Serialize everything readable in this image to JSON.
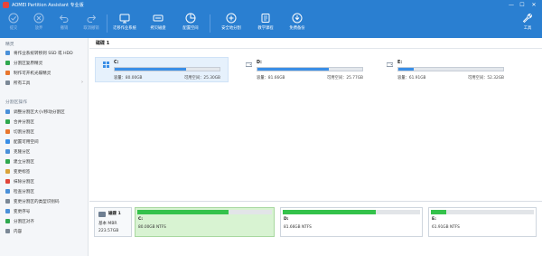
{
  "app": {
    "title": "AOMEI Partition Assistant 专业版"
  },
  "window_controls": {
    "minimize": "—",
    "maximize": "☐",
    "close": "✕"
  },
  "toolbar": {
    "buttons": [
      {
        "label": "提交",
        "icon": "check-icon",
        "enabled": false
      },
      {
        "label": "放弃",
        "icon": "discard-icon",
        "enabled": false
      },
      {
        "label": "撤销",
        "icon": "undo-icon",
        "enabled": false
      },
      {
        "label": "取消撤销",
        "icon": "redo-icon",
        "enabled": false
      },
      {
        "label": "迁移作业系统",
        "icon": "migrate-os-icon",
        "enabled": true
      },
      {
        "label": "拷贝磁盘",
        "icon": "copy-disk-icon",
        "enabled": true
      },
      {
        "label": "配置空间",
        "icon": "allocate-space-icon",
        "enabled": true
      },
      {
        "label": "安全地分割",
        "icon": "secure-split-icon",
        "enabled": true
      },
      {
        "label": "教学课程",
        "icon": "tutorial-icon",
        "enabled": true
      },
      {
        "label": "免费备份",
        "icon": "free-backup-icon",
        "enabled": true
      }
    ],
    "tools_label": "工具"
  },
  "sidebar": {
    "wizard_heading": "精灵",
    "wizard_items": [
      {
        "label": "将作业系统转移到 SSD 或 HDD",
        "icon": "migrate-icon",
        "color": "#4a90d9"
      },
      {
        "label": "分割区复原精灵",
        "icon": "recovery-icon",
        "color": "#2fa84f"
      },
      {
        "label": "制作可开机光碟精灵",
        "icon": "bootable-media-icon",
        "color": "#e8762d"
      },
      {
        "label": "所有工具",
        "icon": "all-tools-icon",
        "color": "#7b8896",
        "chevron": "›"
      }
    ],
    "ops_heading": "分割区操作",
    "ops_items": [
      {
        "label": "调整分割区大小/移动分割区",
        "icon": "resize-icon",
        "color": "#4a90d9"
      },
      {
        "label": "合并分割区",
        "icon": "merge-icon",
        "color": "#2fa84f"
      },
      {
        "label": "切割分割区",
        "icon": "split-icon",
        "color": "#e8762d"
      },
      {
        "label": "配置可用空间",
        "icon": "allocate-icon",
        "color": "#3a8ee6"
      },
      {
        "label": "克隆分区",
        "icon": "clone-icon",
        "color": "#4a90d9"
      },
      {
        "label": "建立分割区",
        "icon": "create-icon",
        "color": "#2fa84f"
      },
      {
        "label": "变更标签",
        "icon": "label-icon",
        "color": "#d9a33a"
      },
      {
        "label": "抹除分割区",
        "icon": "wipe-icon",
        "color": "#e0453a"
      },
      {
        "label": "检查分割区",
        "icon": "check-partition-icon",
        "color": "#4a90d9"
      },
      {
        "label": "变更分割区的类型识别码",
        "icon": "type-id-icon",
        "color": "#7b8896"
      },
      {
        "label": "变更序号",
        "icon": "serial-icon",
        "color": "#4a90d9"
      },
      {
        "label": "分割区对齐",
        "icon": "align-icon",
        "color": "#2fa84f"
      },
      {
        "label": "内容",
        "icon": "properties-icon",
        "color": "#7b8896"
      }
    ]
  },
  "main": {
    "disk_title": "磁碟 1",
    "partitions": [
      {
        "letter": "C:",
        "capacity": "容量：80.00GB",
        "free": "可用空间：25.30GB",
        "used_fraction": 0.68,
        "selected": true,
        "icon": "windows-drive-icon"
      },
      {
        "letter": "D:",
        "capacity": "容量：81.66GB",
        "free": "可用空间：25.77GB",
        "used_fraction": 0.68,
        "selected": false,
        "icon": "drive-icon"
      },
      {
        "letter": "E:",
        "capacity": "容量：61.91GB",
        "free": "可用空间：52.32GB",
        "used_fraction": 0.15,
        "selected": false,
        "icon": "drive-icon"
      }
    ]
  },
  "diskmap": {
    "disk_name": "磁碟 1",
    "disk_type": "基本 MBR",
    "disk_size": "223.57GB",
    "parts": [
      {
        "letter": "C:",
        "info": "80.00GB NTFS",
        "used_fraction": 0.68,
        "selected": true
      },
      {
        "letter": "D:",
        "info": "81.66GB NTFS",
        "used_fraction": 0.68,
        "selected": false
      },
      {
        "letter": "E:",
        "info": "61.91GB NTFS",
        "used_fraction": 0.15,
        "selected": false
      }
    ]
  },
  "colors": {
    "toolbar_blue": "#2a7fd1",
    "usage_blue": "#3a8ee6",
    "usage_green": "#34c24b",
    "selected_card_bg": "#e6f1fc",
    "selected_map_bg": "#d8f3d2"
  }
}
